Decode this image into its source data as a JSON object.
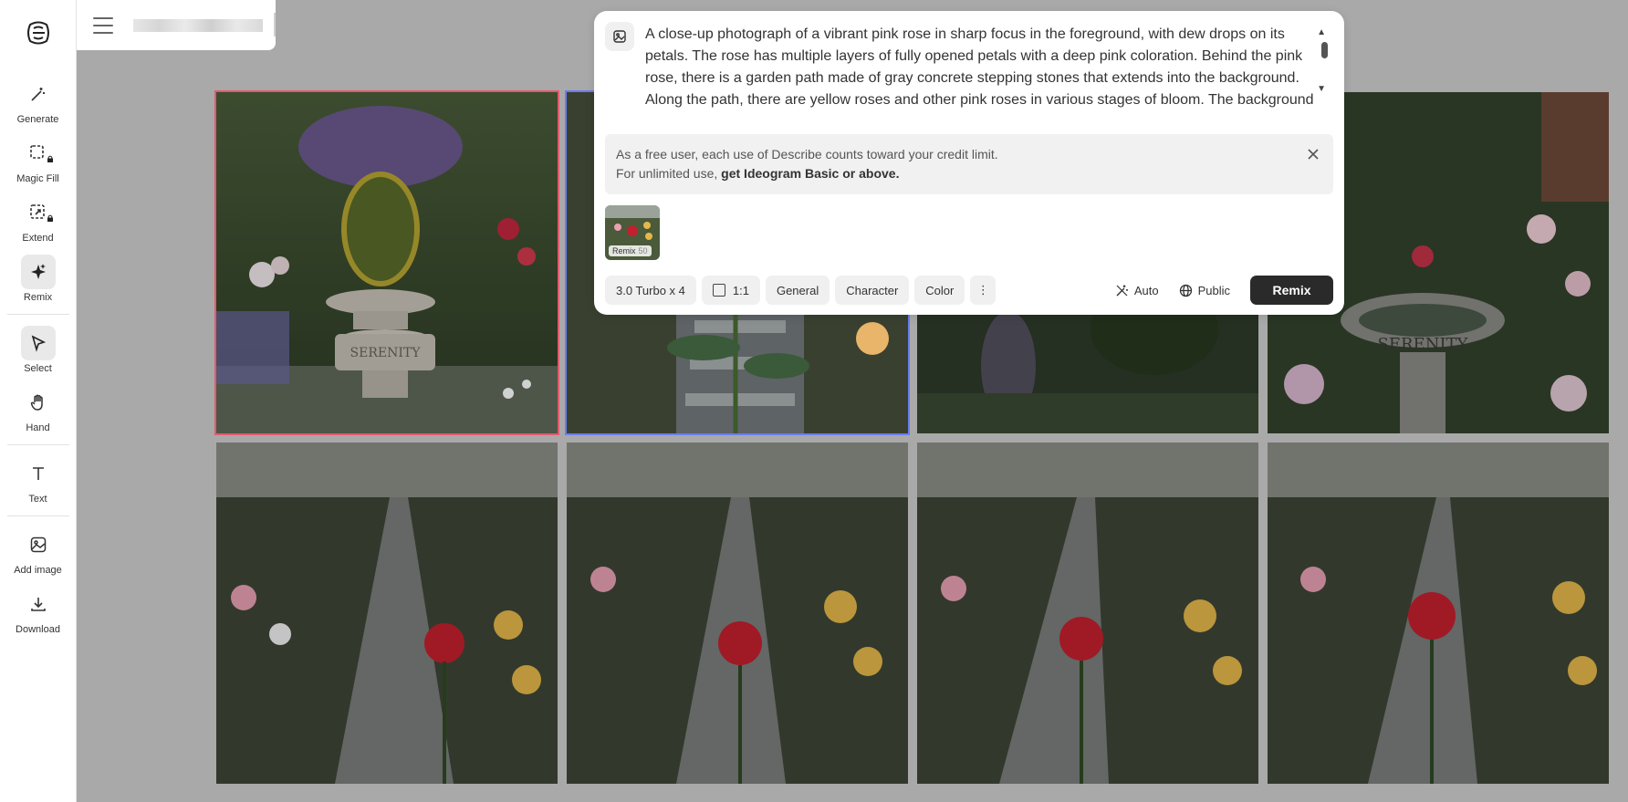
{
  "sidebar": {
    "tools": [
      {
        "label": "Generate",
        "icon": "wand-icon"
      },
      {
        "label": "Magic Fill",
        "icon": "magic-fill-icon",
        "locked": true
      },
      {
        "label": "Extend",
        "icon": "extend-icon",
        "locked": true
      },
      {
        "label": "Remix",
        "icon": "sparkle-icon",
        "active": true
      },
      {
        "label": "Select",
        "icon": "cursor-icon",
        "active": true
      },
      {
        "label": "Hand",
        "icon": "hand-icon"
      },
      {
        "label": "Text",
        "icon": "text-icon"
      },
      {
        "label": "Add image",
        "icon": "add-image-icon"
      },
      {
        "label": "Download",
        "icon": "download-icon"
      }
    ]
  },
  "panel": {
    "prompt": "A close-up photograph of a vibrant pink rose in sharp focus in the foreground, with dew drops on its petals. The rose has multiple layers of fully opened petals with a deep pink coloration. Behind the pink rose, there is a garden path made of gray concrete stepping stones that extends into the background. Along the path, there are yellow roses and other pink roses in various stages of bloom. The background",
    "notice_line1": "As a free user, each use of Describe counts toward your credit limit.",
    "notice_line2_prefix": "For unlimited use, ",
    "notice_line2_link": "get Ideogram Basic or above.",
    "thumb_badge": "Remix",
    "thumb_badge_value": "50",
    "model_label": "3.0 Turbo x 4",
    "aspect_label": "1:1",
    "style_general": "General",
    "style_character": "Character",
    "style_color": "Color",
    "more_label": "⋮",
    "magic_prompt_label": "Auto",
    "visibility_label": "Public",
    "submit_label": "Remix"
  },
  "grid": {
    "fountain_text": "SERENITY",
    "birdbath_text": "SERENITY"
  },
  "colors": {
    "accent_dark": "#2a2a2a",
    "selection_red": "#e35a6f",
    "selection_blue": "#6b7cf0"
  }
}
